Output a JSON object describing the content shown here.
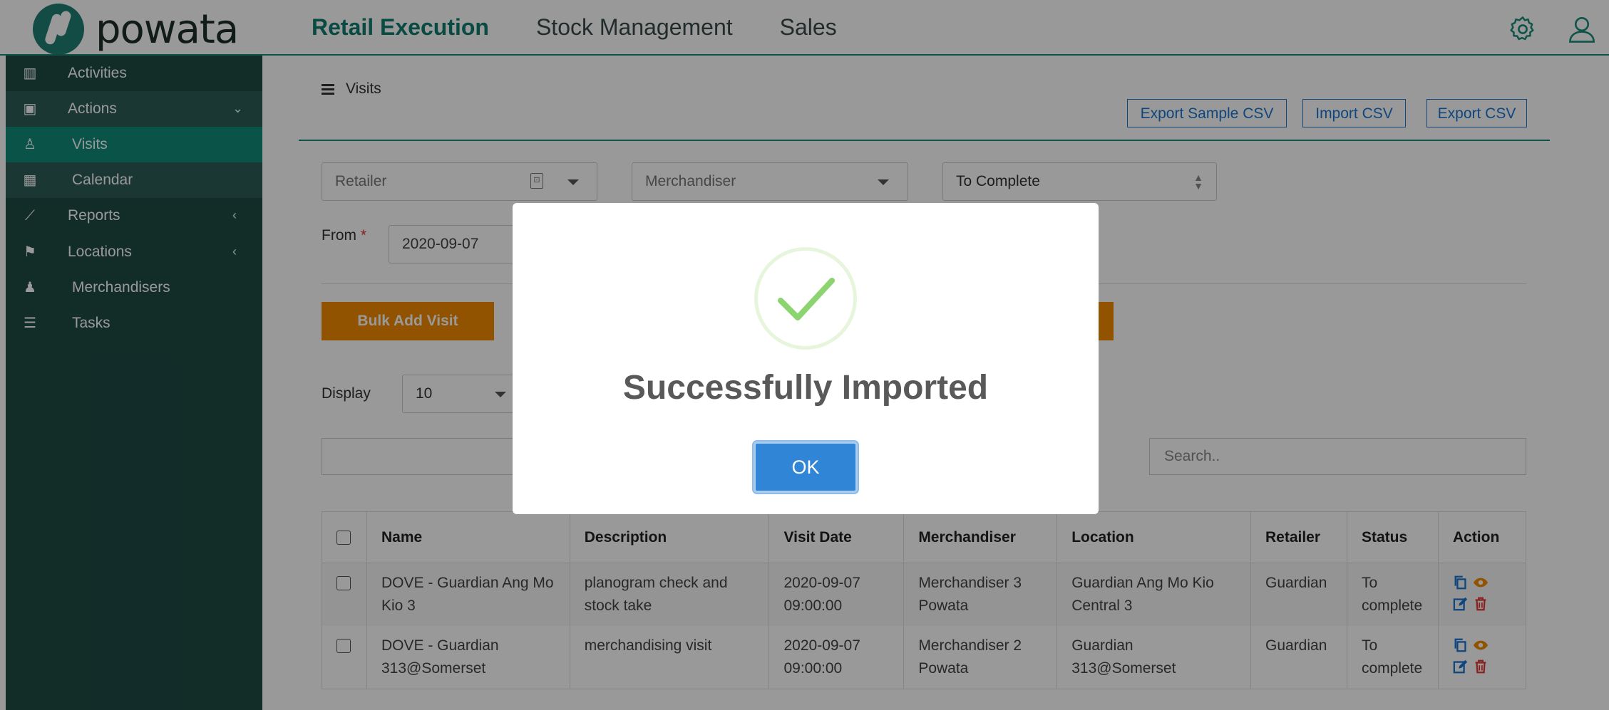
{
  "header": {
    "logo_text": "powata",
    "nav": [
      {
        "label": "Retail Execution",
        "active": true
      },
      {
        "label": "Stock Management",
        "active": false
      },
      {
        "label": "Sales",
        "active": false
      }
    ],
    "icons": [
      "gear-icon",
      "user-icon"
    ]
  },
  "sidebar": {
    "items": [
      {
        "label": "Activities",
        "icon": "bar-chart-icon"
      },
      {
        "label": "Actions",
        "icon": "calendar-plus-icon",
        "chevron": "⌄"
      },
      {
        "label": "Visits",
        "icon": "person-pin-icon"
      },
      {
        "label": "Calendar",
        "icon": "calendar-icon"
      },
      {
        "label": "Reports",
        "icon": "line-chart-icon",
        "chevron": "‹"
      },
      {
        "label": "Locations",
        "icon": "map-icon",
        "chevron": "‹"
      },
      {
        "label": "Merchandisers",
        "icon": "people-icon"
      },
      {
        "label": "Tasks",
        "icon": "list-icon"
      }
    ]
  },
  "page": {
    "breadcrumb": "Visits",
    "buttons": {
      "export_sample_csv": "Export Sample CSV",
      "import_csv": "Import CSV",
      "export_csv": "Export CSV",
      "bulk_add_visit": "Bulk Add Visit"
    },
    "filters": {
      "retailer_placeholder": "Retailer",
      "merchandiser_placeholder": "Merchandiser",
      "status_value": "To Complete",
      "from_label": "From",
      "required_mark": "*",
      "from_value": "2020-09-07"
    },
    "display_label": "Display",
    "display_value": "10",
    "search_placeholder": "Search.."
  },
  "table": {
    "columns": [
      "Name",
      "Description",
      "Visit Date",
      "Merchandiser",
      "Location",
      "Retailer",
      "Status",
      "Action"
    ],
    "rows": [
      {
        "name": "DOVE - Guardian Ang Mo Kio 3",
        "description": "planogram check and stock take",
        "visit_date": "2020-09-07 09:00:00",
        "merchandiser": "Merchandiser 3 Powata",
        "location": "Guardian Ang Mo Kio Central 3",
        "retailer": "Guardian",
        "status": "To complete"
      },
      {
        "name": "DOVE - Guardian 313@Somerset",
        "description": "merchandising visit",
        "visit_date": "2020-09-07 09:00:00",
        "merchandiser": "Merchandiser 2 Powata",
        "location": "Guardian 313@Somerset",
        "retailer": "Guardian",
        "status": "To complete"
      }
    ]
  },
  "dialog": {
    "title": "Successfully Imported",
    "ok_label": "OK"
  },
  "colors": {
    "brand": "#0f7d6f",
    "sidebar": "#1e4a44",
    "sidebar_active": "#0f8b7a",
    "accent_blue": "#1976d2",
    "orange": "#f28b00",
    "success": "#8cd46f",
    "ok_button": "#3085d6"
  }
}
